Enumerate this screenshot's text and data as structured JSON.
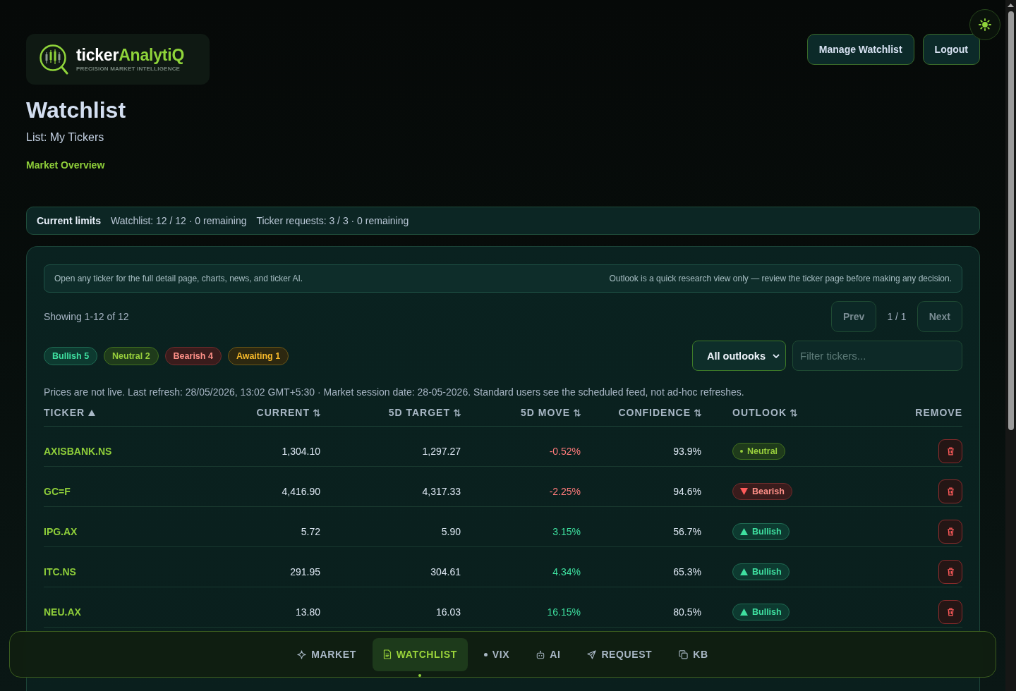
{
  "brand": {
    "name": "ticker",
    "name_accent": "AnalytiQ",
    "tagline": "PRECISION MARKET INTELLIGENCE"
  },
  "header_buttons": [
    "Manage Watchlist",
    "Logout"
  ],
  "page": {
    "title": "Watchlist",
    "subtitle": "List: My Tickers",
    "link": "Market Overview"
  },
  "limits": {
    "label": "Current limits",
    "items": [
      "Watchlist: 12 / 12 · 0 remaining",
      "Ticker requests: 3 / 3 · 0 remaining"
    ]
  },
  "watchlist": {
    "notice": {
      "left": "Open any ticker for the full detail page, charts, news, and ticker AI.",
      "right": "Outlook is a quick research view only — review the ticker page before making any decision."
    },
    "showing": "Showing 1-12 of 12",
    "pagination": {
      "prev": {
        "label": "Prev",
        "disabled": true
      },
      "page": "1 / 1",
      "next": {
        "label": "Next",
        "disabled": true
      }
    },
    "filter_chips": [
      {
        "label": "Bullish 5",
        "kind": "bullish"
      },
      {
        "label": "Neutral 2",
        "kind": "neutral"
      },
      {
        "label": "Bearish 4",
        "kind": "bearish"
      },
      {
        "label": "Awaiting 1",
        "kind": "awaiting"
      }
    ],
    "outlook_select": {
      "value": "All outlooks"
    },
    "search": {
      "placeholder": "Filter tickers..."
    },
    "price_note": "Prices are not live. Last refresh: 28/05/2026, 13:02 GMT+5:30 · Market session date: 28-05-2026. Standard users see the scheduled feed, not ad-hoc refreshes.",
    "table": {
      "columns": [
        {
          "label": "TICKER",
          "kind": "sorted"
        },
        {
          "label": "CURRENT",
          "kind": "sortable"
        },
        {
          "label": "5D TARGET",
          "kind": "sortable"
        },
        {
          "label": "5D MOVE",
          "kind": "sortable"
        },
        {
          "label": "CONFIDENCE",
          "kind": "sortable"
        },
        {
          "label": "OUTLOOK",
          "kind": "sortable"
        },
        {
          "label": "REMOVE",
          "kind": "static"
        }
      ],
      "rows": [
        {
          "ticker": "AXISBANK.NS",
          "current": "1,304.10",
          "target": "1,297.27",
          "move": {
            "text": "-0.52%",
            "kind": "loss"
          },
          "confidence": "93.9%",
          "outlook": {
            "label": "Neutral",
            "kind": "neutral"
          }
        },
        {
          "ticker": "GC=F",
          "current": "4,416.90",
          "target": "4,317.33",
          "move": {
            "text": "-2.25%",
            "kind": "loss"
          },
          "confidence": "94.6%",
          "outlook": {
            "label": "Bearish",
            "kind": "bearish"
          }
        },
        {
          "ticker": "IPG.AX",
          "current": "5.72",
          "target": "5.90",
          "move": {
            "text": "3.15%",
            "kind": "gain"
          },
          "confidence": "56.7%",
          "outlook": {
            "label": "Bullish",
            "kind": "bullish"
          }
        },
        {
          "ticker": "ITC.NS",
          "current": "291.95",
          "target": "304.61",
          "move": {
            "text": "4.34%",
            "kind": "gain"
          },
          "confidence": "65.3%",
          "outlook": {
            "label": "Bullish",
            "kind": "bullish"
          }
        },
        {
          "ticker": "NEU.AX",
          "current": "13.80",
          "target": "16.03",
          "move": {
            "text": "16.15%",
            "kind": "gain"
          },
          "confidence": "80.5%",
          "outlook": {
            "label": "Bullish",
            "kind": "bullish"
          }
        }
      ]
    }
  },
  "bottom_nav": [
    {
      "label": "MARKET",
      "selected": false
    },
    {
      "label": "WATCHLIST",
      "selected": true
    },
    {
      "label": "VIX",
      "selected": false
    },
    {
      "label": "AI",
      "selected": false
    },
    {
      "label": "REQUEST",
      "selected": false
    },
    {
      "label": "KB",
      "selected": false
    }
  ]
}
